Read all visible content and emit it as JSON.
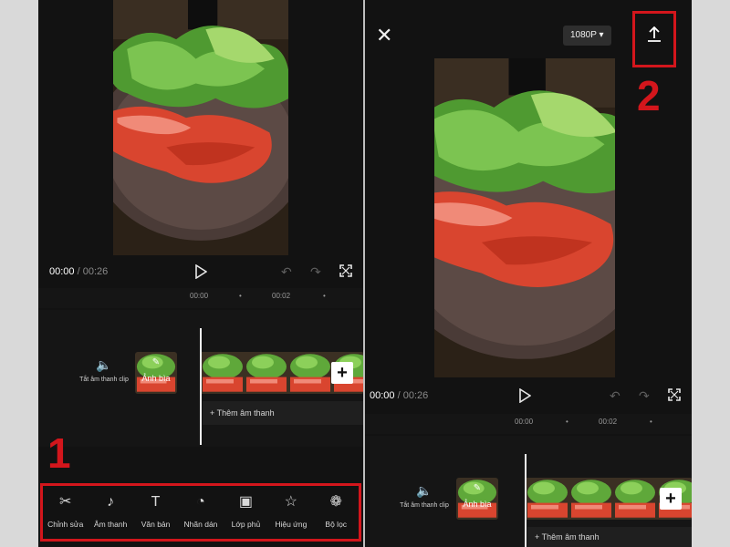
{
  "player": {
    "current_time": "00:00",
    "separator": "/",
    "duration": "00:26"
  },
  "ruler": {
    "mark1": "00:00",
    "mark2": "00:02",
    "dot": "•"
  },
  "timeline": {
    "mute_label": "Tắt âm thanh clip",
    "cover_label": "Ảnh bìa",
    "add_audio": "Thêm âm thanh",
    "add_button": "+"
  },
  "toolbar": {
    "items": [
      {
        "label": "Chỉnh sửa",
        "icon": "scissors-icon"
      },
      {
        "label": "Âm thanh",
        "icon": "music-note-icon"
      },
      {
        "label": "Văn bản",
        "icon": "text-icon"
      },
      {
        "label": "Nhãn dán",
        "icon": "sticker-icon"
      },
      {
        "label": "Lớp phủ",
        "icon": "overlay-icon"
      },
      {
        "label": "Hiệu ứng",
        "icon": "effects-icon"
      },
      {
        "label": "Bộ lọc",
        "icon": "filter-icon"
      }
    ]
  },
  "export": {
    "resolution": "1080P"
  },
  "annotations": {
    "step1": "1",
    "step2": "2"
  },
  "colors": {
    "background": "#121212",
    "highlight": "#d3161c",
    "food_red": "#d9452f",
    "greens": "#5fa83a"
  }
}
